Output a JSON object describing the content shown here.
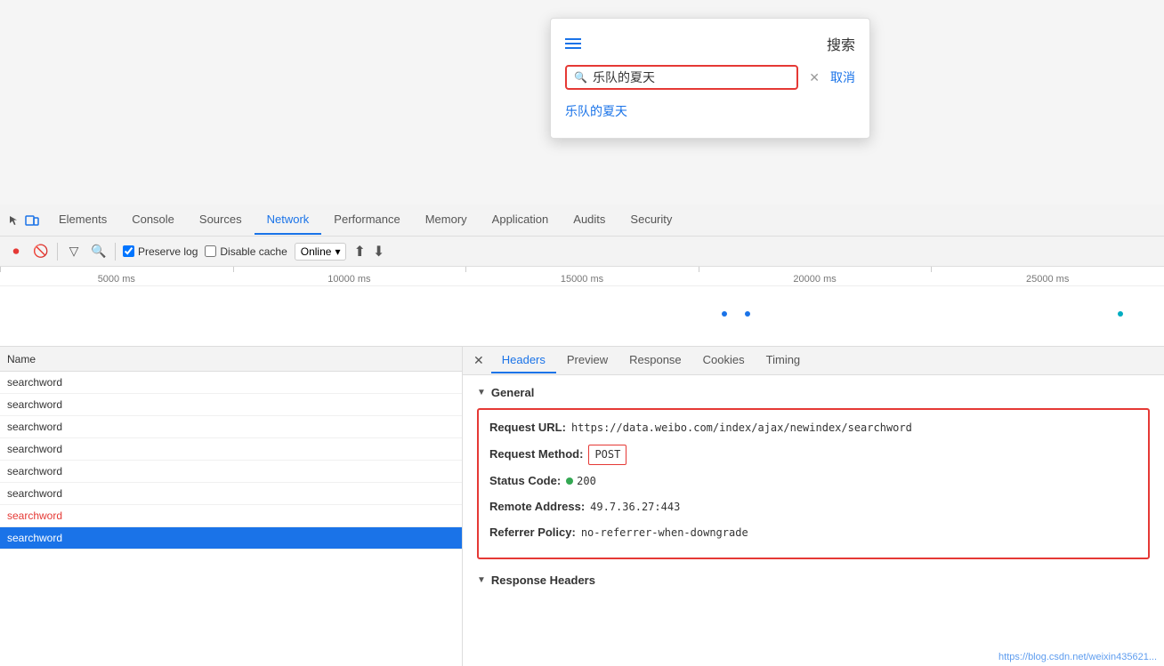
{
  "search_overlay": {
    "title": "搜索",
    "input_value": "乐队的夏天",
    "suggestion": "乐队的夏天",
    "cancel_label": "取消"
  },
  "devtools": {
    "tabs": [
      {
        "label": "Elements",
        "active": false
      },
      {
        "label": "Console",
        "active": false
      },
      {
        "label": "Sources",
        "active": false
      },
      {
        "label": "Network",
        "active": true
      },
      {
        "label": "Performance",
        "active": false
      },
      {
        "label": "Memory",
        "active": false
      },
      {
        "label": "Application",
        "active": false
      },
      {
        "label": "Audits",
        "active": false
      },
      {
        "label": "Security",
        "active": false
      }
    ]
  },
  "toolbar": {
    "preserve_log_label": "Preserve log",
    "disable_cache_label": "Disable cache",
    "online_label": "Online"
  },
  "timeline": {
    "ticks": [
      "5000 ms",
      "10000 ms",
      "15000 ms",
      "20000 ms",
      "25000 ms"
    ]
  },
  "requests": {
    "column_name": "Name",
    "items": [
      {
        "name": "searchword",
        "selected": false,
        "red": false
      },
      {
        "name": "searchword",
        "selected": false,
        "red": false
      },
      {
        "name": "searchword",
        "selected": false,
        "red": false
      },
      {
        "name": "searchword",
        "selected": false,
        "red": false
      },
      {
        "name": "searchword",
        "selected": false,
        "red": false
      },
      {
        "name": "searchword",
        "selected": false,
        "red": false
      },
      {
        "name": "searchword",
        "selected": false,
        "red": true
      },
      {
        "name": "searchword",
        "selected": true,
        "red": false
      }
    ]
  },
  "detail_tabs": [
    {
      "label": "Headers",
      "active": true
    },
    {
      "label": "Preview",
      "active": false
    },
    {
      "label": "Response",
      "active": false
    },
    {
      "label": "Cookies",
      "active": false
    },
    {
      "label": "Timing",
      "active": false
    }
  ],
  "general": {
    "section_title": "General",
    "request_url_label": "Request URL:",
    "request_url_value": "https://data.weibo.com/index/ajax/newindex/searchword",
    "method_label": "Request Method:",
    "method_value": "POST",
    "status_code_label": "Status Code:",
    "status_code_value": "200",
    "remote_address_label": "Remote Address:",
    "remote_address_value": "49.7.36.27:443",
    "referrer_policy_label": "Referrer Policy:",
    "referrer_policy_value": "no-referrer-when-downgrade"
  },
  "response_headers": {
    "section_title": "Response Headers"
  },
  "watermark": "https://blog.csdn.net/weixin435621..."
}
